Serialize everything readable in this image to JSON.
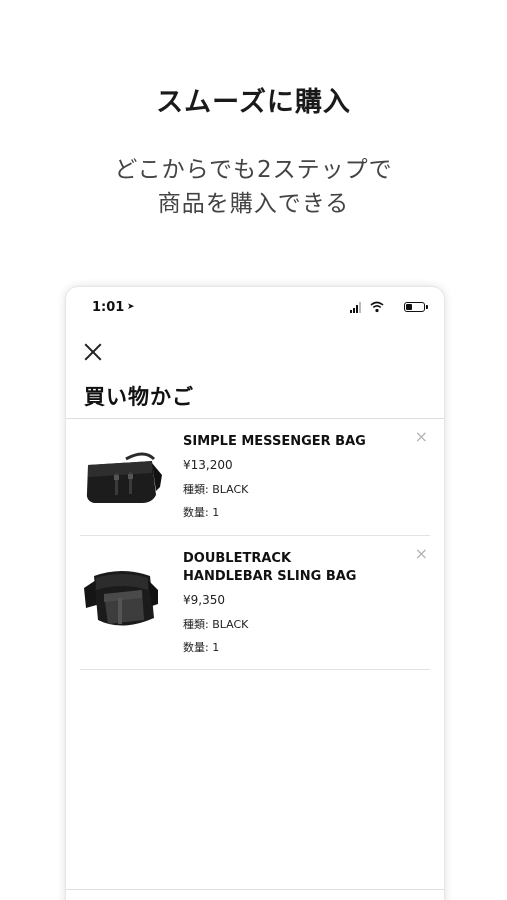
{
  "promo": {
    "title": "スムーズに購入",
    "subtitle_line1": "どこからでも2ステップで",
    "subtitle_line2": "商品を購入できる"
  },
  "status_bar": {
    "time": "1:01",
    "location_icon": "location-arrow-icon",
    "signal_icon": "cellular-signal-icon",
    "wifi_icon": "wifi-icon",
    "battery_icon": "battery-icon"
  },
  "cart": {
    "title": "買い物かご",
    "close_icon": "close-icon",
    "items": [
      {
        "name_lines": [
          "SIMPLE MESSENGER BAG"
        ],
        "price": "¥13,200",
        "variant": "種類: BLACK",
        "quantity": "数量: 1",
        "remove_icon": "remove-icon"
      },
      {
        "name_lines": [
          "DOUBLETRACK",
          "HANDLEBAR SLING BAG"
        ],
        "price": "¥9,350",
        "variant": "種類: BLACK",
        "quantity": "数量: 1",
        "remove_icon": "remove-icon"
      }
    ]
  }
}
